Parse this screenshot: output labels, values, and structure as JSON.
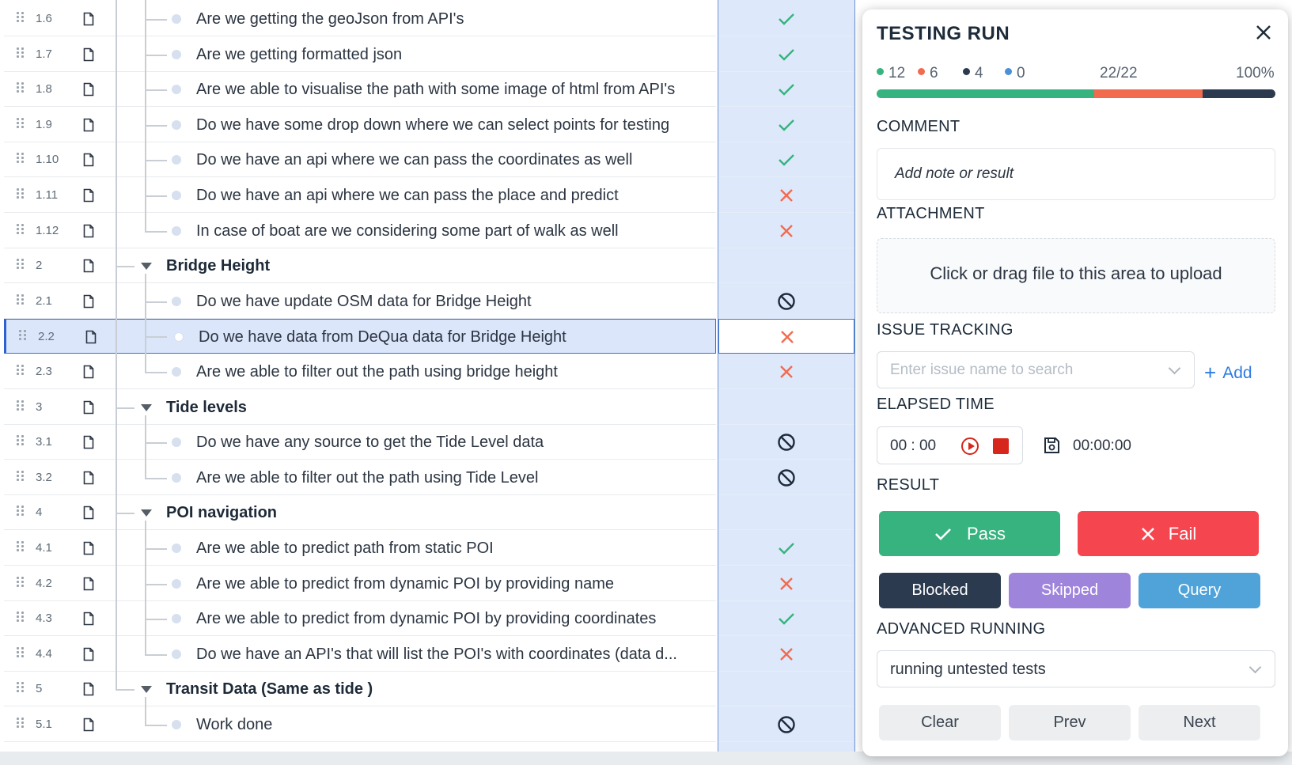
{
  "tree": {
    "rows": [
      {
        "id": "1.6",
        "title": "Are we getting the geoJson from API's",
        "type": "child",
        "status": "pass"
      },
      {
        "id": "1.7",
        "title": "Are we getting formatted json",
        "type": "child",
        "status": "pass"
      },
      {
        "id": "1.8",
        "title": "Are we able to visualise the path with some image of html from API's",
        "type": "child",
        "status": "pass"
      },
      {
        "id": "1.9",
        "title": "Do we have some drop down where we can select points for testing",
        "type": "child",
        "status": "pass"
      },
      {
        "id": "1.10",
        "title": "Do we have an api where we can pass the coordinates as well",
        "type": "child",
        "status": "pass"
      },
      {
        "id": "1.11",
        "title": "Do we have an api where we can pass the place and predict",
        "type": "child",
        "status": "fail"
      },
      {
        "id": "1.12",
        "title": "In case of boat are we considering some part of walk as well",
        "type": "child",
        "status": "fail"
      },
      {
        "id": "2",
        "title": "Bridge Height",
        "type": "group",
        "status": ""
      },
      {
        "id": "2.1",
        "title": "Do we have update OSM data for Bridge Height",
        "type": "child",
        "status": "blocked"
      },
      {
        "id": "2.2",
        "title": "Do we have data from DeQua data for Bridge Height",
        "type": "child",
        "status": "fail",
        "selected": true
      },
      {
        "id": "2.3",
        "title": "Are we able to filter out the path using bridge height",
        "type": "child",
        "status": "fail"
      },
      {
        "id": "3",
        "title": "Tide levels",
        "type": "group",
        "status": ""
      },
      {
        "id": "3.1",
        "title": "Do we have any source to get the Tide Level data",
        "type": "child",
        "status": "blocked"
      },
      {
        "id": "3.2",
        "title": "Are we able to filter out the path using Tide Level",
        "type": "child",
        "status": "blocked"
      },
      {
        "id": "4",
        "title": "POI navigation",
        "type": "group",
        "status": ""
      },
      {
        "id": "4.1",
        "title": "Are we able to predict path from static POI",
        "type": "child",
        "status": "pass"
      },
      {
        "id": "4.2",
        "title": "Are we able to predict from dynamic POI by providing name",
        "type": "child",
        "status": "fail"
      },
      {
        "id": "4.3",
        "title": "Are we able to predict from dynamic POI by providing coordinates",
        "type": "child",
        "status": "pass"
      },
      {
        "id": "4.4",
        "title": "Do we have an API's that will list the POI's with coordinates (data d...",
        "type": "child",
        "status": "fail"
      },
      {
        "id": "5",
        "title": "Transit Data (Same as tide )",
        "type": "group",
        "status": ""
      },
      {
        "id": "5.1",
        "title": "Work done",
        "type": "child",
        "status": "blocked"
      }
    ]
  },
  "panel": {
    "title": "TESTING RUN",
    "stats": {
      "passed": "12",
      "failed": "6",
      "blocked": "4",
      "other": "0",
      "progress": "22/22",
      "percent": "100%"
    },
    "progress_fraction": {
      "pass": 0.545,
      "fail": 0.273,
      "blocked": 0.182
    },
    "comment_label": "COMMENT",
    "comment_placeholder": "Add note or result",
    "attachment_label": "ATTACHMENT",
    "upload_text": "Click or drag file to this area to upload",
    "issue_label": "ISSUE TRACKING",
    "issue_placeholder": "Enter issue name to search",
    "add_label": "Add",
    "elapsed_label": "ELAPSED TIME",
    "timer_value": "00 : 00",
    "elapsed_value": "00:00:00",
    "result_label": "RESULT",
    "pass_label": "Pass",
    "fail_label": "Fail",
    "blocked_label": "Blocked",
    "skipped_label": "Skipped",
    "query_label": "Query",
    "advanced_label": "ADVANCED RUNNING",
    "advanced_value": "running untested tests",
    "clear_label": "Clear",
    "prev_label": "Prev",
    "next_label": "Next"
  },
  "colors": {
    "pass": "#36b37e",
    "fail": "#f26b4f",
    "blocked": "#2c3a4f",
    "other": "#4a90d9",
    "skipped": "#9f84dc",
    "query": "#4fa3d9",
    "fail_button": "#f5454f"
  }
}
